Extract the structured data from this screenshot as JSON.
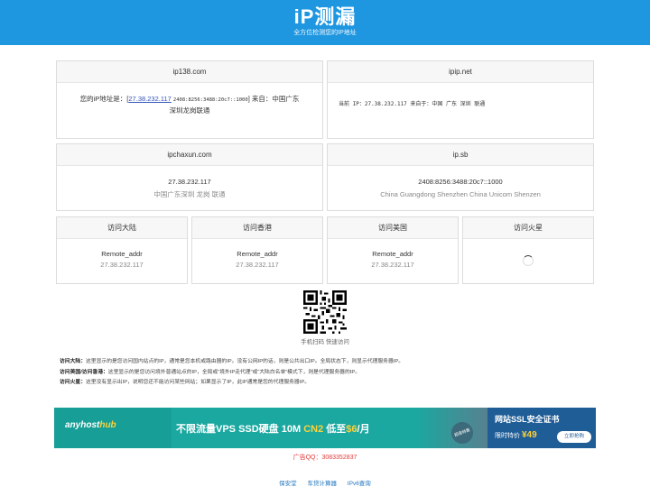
{
  "header": {
    "logo": "iP测漏",
    "tagline": "全方位检测您的IP地址"
  },
  "cards_top": [
    {
      "title": "ip138.com",
      "prefix": "您的iP地址是：[",
      "ip": "27.38.232.117",
      "ipv6": "2408:8256:3488:20c7::1000",
      "suffix": "] 来自：中国广东深圳龙岗联通"
    },
    {
      "title": "ipip.net",
      "text": "当前 IP：27.38.232.117  来自于：中国 广东 深圳  联通"
    }
  ],
  "cards_mid": [
    {
      "title": "ipchaxun.com",
      "line1": "27.38.232.117",
      "line2": "中国广东深圳 龙岗 联通"
    },
    {
      "title": "ip.sb",
      "line1": "2408:8256:3488:20c7::1000",
      "line2": "China Guangdong Shenzhen China Unicom Shenzen"
    }
  ],
  "cards_access": [
    {
      "title": "访问大陆",
      "label": "Remote_addr",
      "ip": "27.38.232.117"
    },
    {
      "title": "访问香港",
      "label": "Remote_addr",
      "ip": "27.38.232.117"
    },
    {
      "title": "访问美国",
      "label": "Remote_addr",
      "ip": "27.38.232.117"
    },
    {
      "title": "访问火星",
      "icon": "loading-spinner-icon"
    }
  ],
  "qr": {
    "caption": "手机扫码 快速访问"
  },
  "notes": [
    {
      "term": "访问大陆：",
      "text": "这里显示的是您访问国内站点的IP，通常是您本机或路由器的IP。没有公网IP的话，则是公共出口IP。全局状态下，则显示代理服务器IP。"
    },
    {
      "term": "访问美国/访问香港：",
      "text": "这里显示的是您访问境外普通站点的IP，全局或“境外IP走代理”或“大陆白名单”模式下，则是代理服务器的IP。"
    },
    {
      "term": "访问火星：",
      "text": "这里没有显示出IP，说明您还不能访问某些网站；如果显示了IP，此IP通常是您的代理服务器IP。"
    }
  ],
  "banner": {
    "brand_a": "anyhost",
    "brand_b": "hub",
    "main_a": "不限流量VPS SSD硬盘 10M ",
    "main_hl1": "CN2",
    "main_b": " 低至",
    "main_hl2": "$6",
    "main_c": "/月",
    "stamp": "超值特惠",
    "right_title": "网站SSL安全证书",
    "right_sub": "限时特价",
    "right_price": "¥49",
    "right_btn": "立即抢购"
  },
  "ad_qq": "广告QQ：3083352837",
  "footer_links": [
    "保安堂",
    "车贷计算器",
    "IPv6查询"
  ],
  "colors": {
    "header": "#1e96e0",
    "link": "#3355bb",
    "ad": "#e23b3b"
  }
}
